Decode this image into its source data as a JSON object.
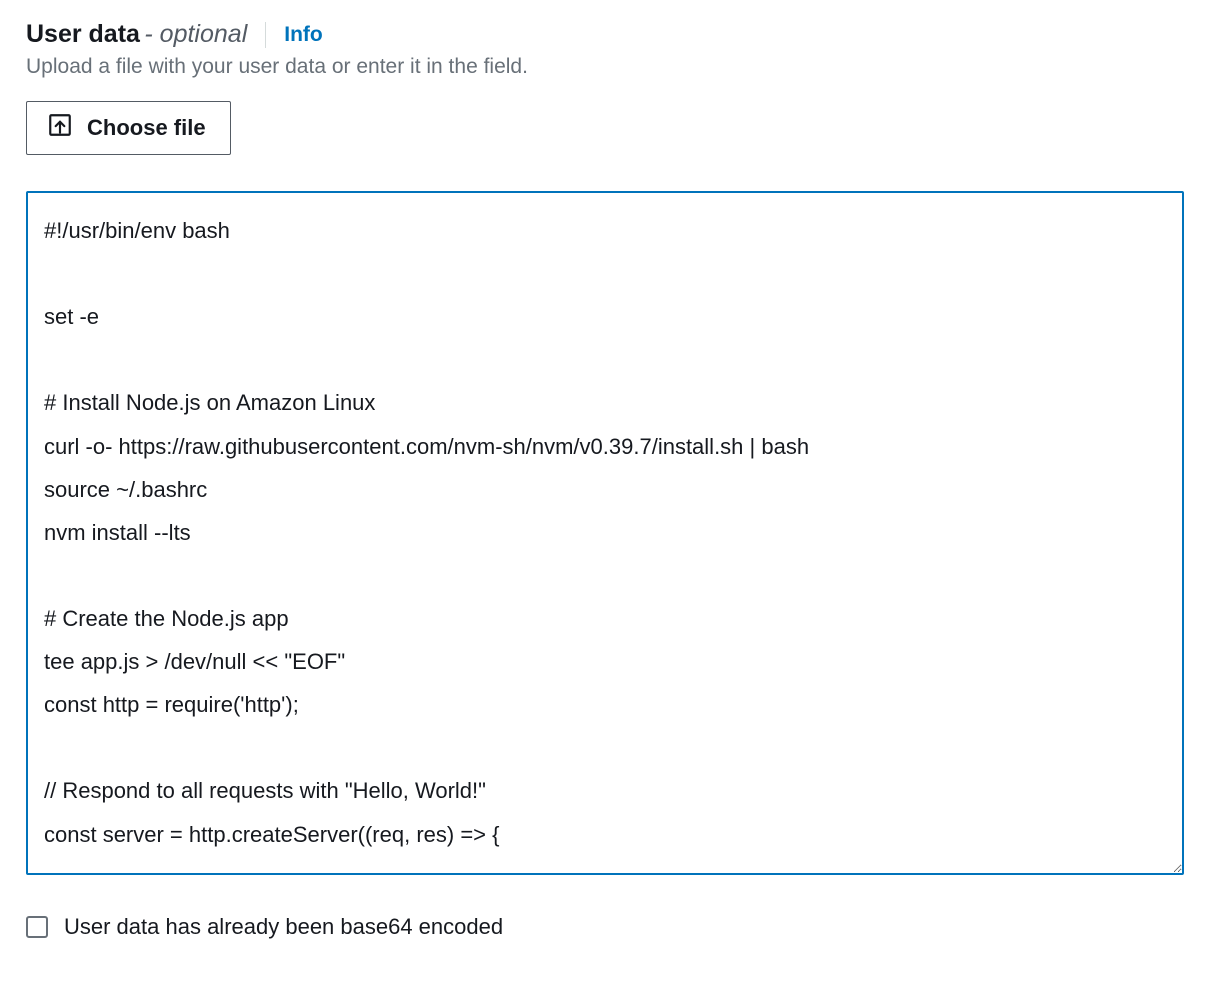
{
  "header": {
    "title": "User data",
    "optional_suffix": "- optional",
    "info_link": "Info",
    "subtitle": "Upload a file with your user data or enter it in the field."
  },
  "choose_file": {
    "label": "Choose file"
  },
  "userdata": {
    "value": "#!/usr/bin/env bash\n\nset -e\n\n# Install Node.js on Amazon Linux\ncurl -o- https://raw.githubusercontent.com/nvm-sh/nvm/v0.39.7/install.sh | bash\nsource ~/.bashrc\nnvm install --lts\n\n# Create the Node.js app\ntee app.js > /dev/null << \"EOF\"\nconst http = require('http');\n\n// Respond to all requests with \"Hello, World!\"\nconst server = http.createServer((req, res) => {"
  },
  "base64_checkbox": {
    "label": "User data has already been base64 encoded",
    "checked": false
  }
}
